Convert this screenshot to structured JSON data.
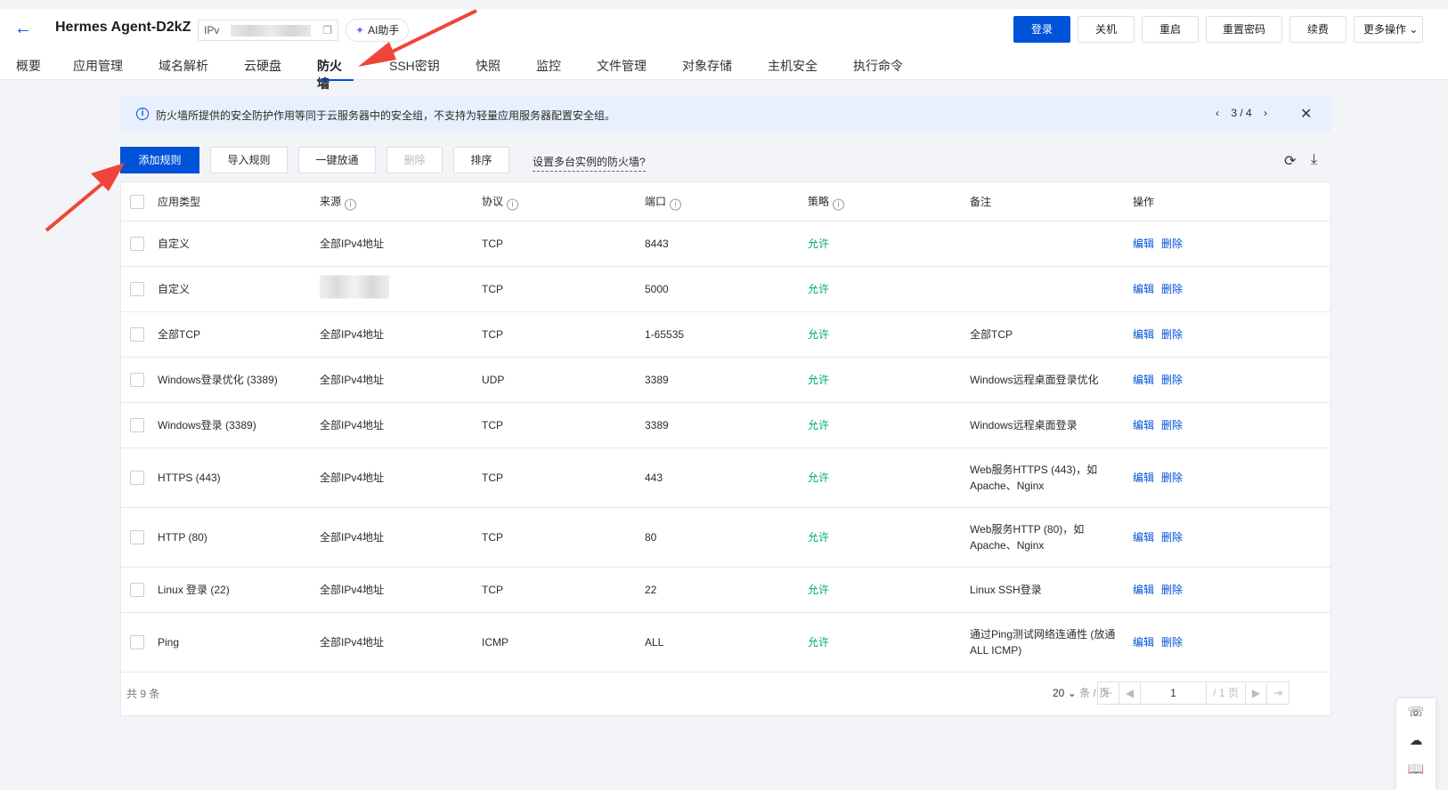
{
  "header": {
    "back_icon": "arrow-left-icon",
    "title": "Hermes Agent-D2kZ",
    "ip_prefix": "IPv",
    "ai_label": "AI助手",
    "buttons": [
      "登录",
      "关机",
      "重启",
      "重置密码",
      "续费",
      "更多操作"
    ]
  },
  "tabs": [
    "概要",
    "应用管理",
    "域名解析",
    "云硬盘",
    "防火墙",
    "SSH密钥",
    "快照",
    "监控",
    "文件管理",
    "对象存储",
    "主机安全",
    "执行命令"
  ],
  "notice": {
    "text": "防火墙所提供的安全防护作用等同于云服务器中的安全组，不支持为轻量应用服务器配置安全组。",
    "pager": "3 / 4"
  },
  "toolbar": {
    "add": "添加规则",
    "import": "导入规则",
    "open_all": "一键放通",
    "delete": "删除",
    "sort": "排序",
    "multi_link": "设置多台实例的防火墙?"
  },
  "table": {
    "headers": [
      "应用类型",
      "来源",
      "协议",
      "端口",
      "策略",
      "备注",
      "操作"
    ],
    "edit_label": "编辑",
    "delete_label": "删除",
    "rows": [
      {
        "type": "自定义",
        "source": "全部IPv4地址",
        "protocol": "TCP",
        "port": "8443",
        "policy": "允许",
        "remark": ""
      },
      {
        "type": "自定义",
        "source": "",
        "protocol": "TCP",
        "port": "5000",
        "policy": "允许",
        "remark": ""
      },
      {
        "type": "全部TCP",
        "source": "全部IPv4地址",
        "protocol": "TCP",
        "port": "1-65535",
        "policy": "允许",
        "remark": "全部TCP"
      },
      {
        "type": "Windows登录优化 (3389)",
        "source": "全部IPv4地址",
        "protocol": "UDP",
        "port": "3389",
        "policy": "允许",
        "remark": "Windows远程桌面登录优化"
      },
      {
        "type": "Windows登录 (3389)",
        "source": "全部IPv4地址",
        "protocol": "TCP",
        "port": "3389",
        "policy": "允许",
        "remark": "Windows远程桌面登录"
      },
      {
        "type": "HTTPS (443)",
        "source": "全部IPv4地址",
        "protocol": "TCP",
        "port": "443",
        "policy": "允许",
        "remark": "Web服务HTTPS (443)，如",
        "remark2": "Apache、Nginx"
      },
      {
        "type": "HTTP (80)",
        "source": "全部IPv4地址",
        "protocol": "TCP",
        "port": "80",
        "policy": "允许",
        "remark": "Web服务HTTP (80)，如",
        "remark2": "Apache、Nginx"
      },
      {
        "type": "Linux 登录 (22)",
        "source": "全部IPv4地址",
        "protocol": "TCP",
        "port": "22",
        "policy": "允许",
        "remark": "Linux SSH登录"
      },
      {
        "type": "Ping",
        "source": "全部IPv4地址",
        "protocol": "ICMP",
        "port": "ALL",
        "policy": "允许",
        "remark": "通过Ping测试网络连通性 (放通",
        "remark2": "ALL ICMP)"
      }
    ]
  },
  "footer": {
    "total": "共 9 条",
    "page_size": "20",
    "page_size_unit": "条 / 页",
    "page_input": "1",
    "page_total": "/ 1 页"
  }
}
